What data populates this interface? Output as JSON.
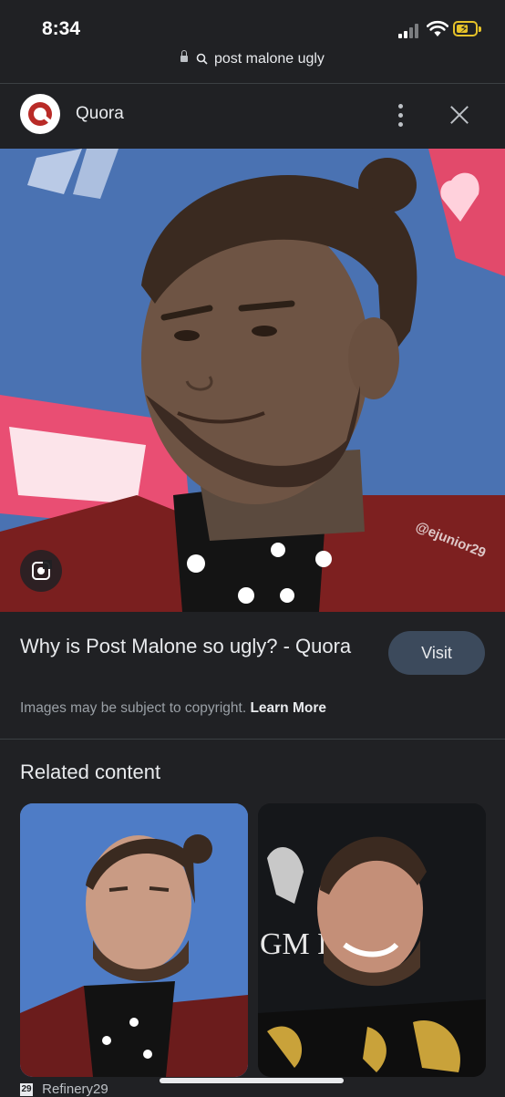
{
  "status": {
    "time": "8:34"
  },
  "urlbar": {
    "query": "post malone ugly"
  },
  "source": {
    "name": "Quora"
  },
  "main_image": {
    "watermark": "@ejunior29",
    "alt": "Edited photo of Post Malone in a red jacket"
  },
  "result": {
    "title": "Why is Post Malone so ugly? - Quora",
    "visit_label": "Visit",
    "copyright_text": "Images may be subject to copyright.",
    "learn_more": "Learn More"
  },
  "related": {
    "heading": "Related content",
    "items": [
      {
        "source": "Refinery29"
      },
      {
        "source": ""
      }
    ],
    "card2_logo_text": "GM D."
  },
  "colors": {
    "quora_red": "#b92b27",
    "battery": "#e6c229",
    "background": "#202124"
  }
}
